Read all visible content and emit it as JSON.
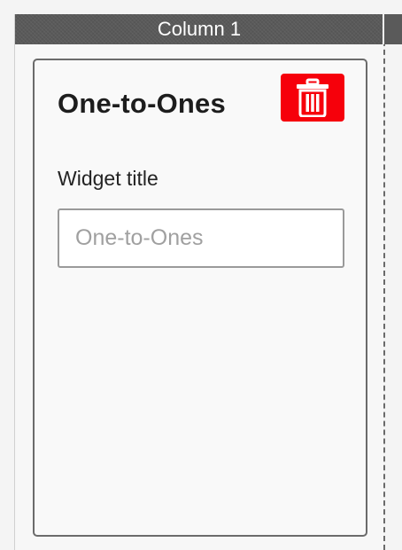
{
  "column": {
    "header": "Column 1"
  },
  "widget": {
    "heading": "One-to-Ones",
    "delete_icon": "trash-icon",
    "field_label": "Widget title",
    "input_value": "",
    "input_placeholder": "One-to-Ones"
  },
  "colors": {
    "header_bg": "#5a5a5a",
    "delete_button": "#f6000b",
    "card_border": "#6b6b6b"
  }
}
